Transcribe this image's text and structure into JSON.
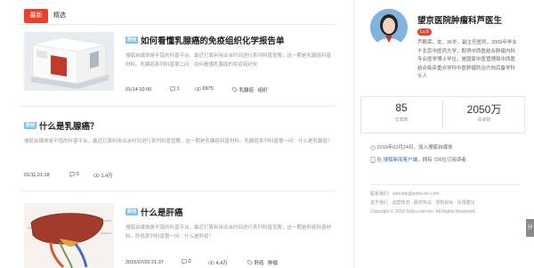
{
  "tabs": {
    "active": "最新",
    "other": "精选"
  },
  "articles": [
    {
      "tag": "原创",
      "title": "如何看懂乳腺癌的免疫组织化学报告单",
      "desc": "搜狐自媒体是不错的科普平台，最近打算利用业余时间进行系列科普宣教，这一期是乳腺癌科普材料。乳腺癌系列科普第二问：如何看懂乳腺癌的免疫组织化",
      "date": "01/14 10:00",
      "comments": "1",
      "views": "6975",
      "tags": [
        "乳腺癌",
        "组织"
      ]
    },
    {
      "tag": "原创",
      "title": "什么是乳腺癌？",
      "desc": "搜狐自媒体是不错的科普平台，最近打算利用业余时间进行系列科普宣教，这一期是乳腺癌科普材料。乳腺癌系列科普第一问：什么是乳腺癌？",
      "date": "01/11 21:18",
      "comments": "0",
      "views": "1.4万"
    },
    {
      "tag": "原创",
      "title": "什么是肝癌",
      "desc": "搜狐自媒体是不错的科普平台，最近打算利用业余时间进行系列科普宣教，这一期是肝癌科普材料。肝癌系列科普第一问：什么是肝癌？",
      "date": "2015/07/20 21:37",
      "comments": "0",
      "views": "4.4万",
      "tags": [
        "肝癌",
        "肿瘤"
      ]
    }
  ],
  "profile": {
    "name": "望京医院肿瘤科芦医生",
    "level": "Lv.5",
    "bio": "芦殿荣，女，36岁，副主任医师，2009年毕业于北京中医药大学，取得中西医结合肿瘤内科专业医学博士学位，是国家中医管理局中西医结合临床重点学科中医肿瘤防治方向后备学科头人",
    "articles_count": "85",
    "articles_label": "文章数",
    "reads_count": "2050万",
    "reads_label": "阅读数",
    "joined": "2015年02月24日，加入搜狐自媒体",
    "rank_prefix": "在",
    "rank_link": "搜狐新闻客户端",
    "rank_suffix": "，拥有 726位订阅读者"
  },
  "footer": {
    "email": "联系我们：sohump@sohu-inc.com",
    "links": "关于我们 · 运营规范 · 服务协议 · 侵权投诉 · 反馈建议",
    "copyright": "Copyright © 2016 Sohu.com Inc. All Rights Reserved."
  },
  "side_tab": "分",
  "icons": {
    "comment": "comment-icon",
    "view": "eye-icon",
    "tag": "tag-icon",
    "clock": "clock-icon",
    "phone": "phone-icon"
  },
  "colors": {
    "accent": "#e8412c",
    "tag": "#7fc1ea",
    "link": "#2b6cb3"
  }
}
